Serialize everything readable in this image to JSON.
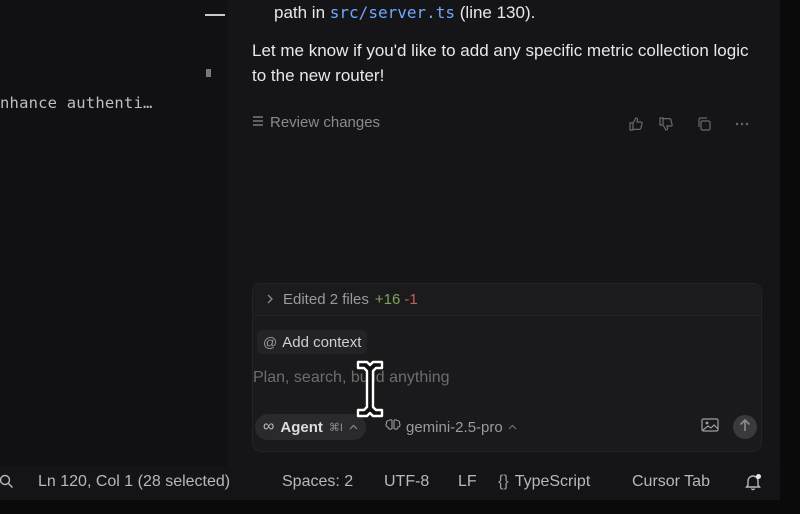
{
  "editor": {
    "code_line": "nhance authenti…"
  },
  "chat": {
    "bullet": {
      "text_before": "path in",
      "code": "src/server.ts",
      "text_after": "(line 130)."
    },
    "message": "Let me know if you'd like to add any specific metric collection logic to the new router!",
    "review_label": "Review changes",
    "icons": [
      "list-icon",
      "thumbs-up-icon",
      "thumbs-down-icon",
      "copy-icon",
      "more-icon"
    ]
  },
  "composer": {
    "edited": {
      "label": "Edited 2 files",
      "additions": "+16",
      "deletions": "-1"
    },
    "add_context_label": "Add context",
    "placeholder": "Plan, search, build anything",
    "mode_label": "Agent",
    "mode_shortcut": "⌘I",
    "model": "gemini-2.5-pro"
  },
  "status_bar": {
    "position": "Ln 120, Col 1 (28 selected)",
    "spaces": "Spaces: 2",
    "encoding": "UTF-8",
    "eol": "LF",
    "language": "TypeScript",
    "cursor_tab": "Cursor Tab"
  },
  "colors": {
    "background": "#151517",
    "accent_code": "#6ea7ff",
    "additions": "#7ea35a",
    "deletions": "#c25d5d"
  }
}
